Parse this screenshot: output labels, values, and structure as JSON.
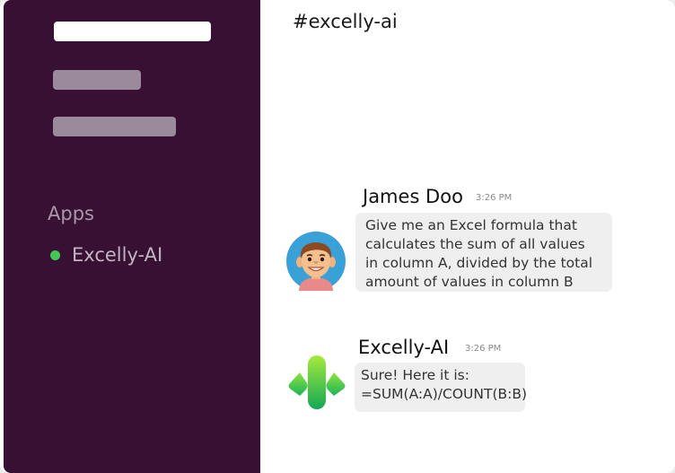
{
  "sidebar": {
    "apps_heading": "Apps",
    "app_items": [
      {
        "label": "Excelly-AI",
        "status_color": "#44c854"
      }
    ]
  },
  "channel": {
    "title": "#excelly-ai"
  },
  "messages": [
    {
      "author": "James Doo",
      "time": "3:26 PM",
      "avatar_icon": "user-avatar-icon",
      "lines": [
        "Give me an Excel formula that",
        "calculates the sum of all values",
        "in column A, divided by the total",
        "amount of values in column B"
      ]
    },
    {
      "author": "Excelly-AI",
      "time": "3:26 PM",
      "avatar_icon": "excelly-logo-icon",
      "lines": [
        "Sure! Here it is:",
        "=SUM(A:A)/COUNT(B:B)"
      ]
    }
  ],
  "colors": {
    "sidebar_bg": "#381034",
    "bubble_bg": "#efefef",
    "logo_green": "#2cc55c"
  }
}
